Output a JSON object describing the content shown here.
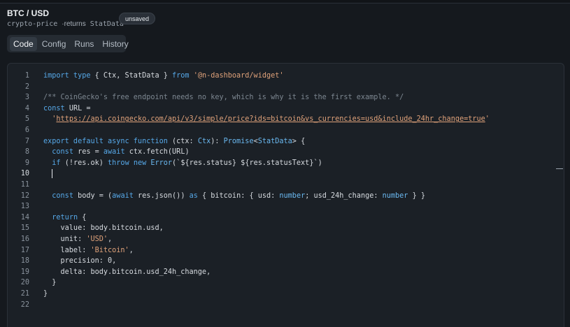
{
  "header": {
    "title": "BTC / USD",
    "widget_id": "crypto-price",
    "separator": "·",
    "returns_label": "returns",
    "return_type": "StatData",
    "badge": "unsaved"
  },
  "tabs": [
    {
      "label": "Code",
      "active": true
    },
    {
      "label": "Config",
      "active": false
    },
    {
      "label": "Runs",
      "active": false
    },
    {
      "label": "History",
      "active": false
    }
  ],
  "editor": {
    "current_line": 10,
    "lines": [
      {
        "n": "1",
        "tokens": [
          [
            "kw",
            "import type "
          ],
          [
            "pn",
            "{ Ctx, StatData } "
          ],
          [
            "kw",
            "from "
          ],
          [
            "str",
            "'@n-dashboard/widget'"
          ]
        ]
      },
      {
        "n": "2",
        "tokens": []
      },
      {
        "n": "3",
        "tokens": [
          [
            "cm",
            "/** CoinGecko's free endpoint needs no key, which is why it is the first example. */"
          ]
        ]
      },
      {
        "n": "4",
        "tokens": [
          [
            "kw",
            "const "
          ],
          [
            "pn",
            "URL ="
          ]
        ]
      },
      {
        "n": "5",
        "tokens": [
          [
            "pn",
            "  "
          ],
          [
            "str",
            "'"
          ],
          [
            "url",
            "https://api.coingecko.com/api/v3/simple/price?ids=bitcoin&vs_currencies=usd&include_24hr_change=true"
          ],
          [
            "str",
            "'"
          ]
        ]
      },
      {
        "n": "6",
        "tokens": []
      },
      {
        "n": "7",
        "tokens": [
          [
            "kw",
            "export default async function "
          ],
          [
            "pn",
            "(ctx: "
          ],
          [
            "ty",
            "Ctx"
          ],
          [
            "pn",
            "): "
          ],
          [
            "ty",
            "Promise"
          ],
          [
            "pn",
            "<"
          ],
          [
            "ty",
            "StatData"
          ],
          [
            "pn",
            "> {"
          ]
        ]
      },
      {
        "n": "8",
        "tokens": [
          [
            "pn",
            "  "
          ],
          [
            "kw",
            "const "
          ],
          [
            "pn",
            "res = "
          ],
          [
            "kw",
            "await "
          ],
          [
            "pn",
            "ctx.fetch(URL)"
          ]
        ]
      },
      {
        "n": "9",
        "tokens": [
          [
            "pn",
            "  "
          ],
          [
            "kw",
            "if "
          ],
          [
            "pn",
            "(!res.ok) "
          ],
          [
            "kw",
            "throw new "
          ],
          [
            "ty",
            "Error"
          ],
          [
            "pn",
            "(`${res.status} ${res.statusText}`)"
          ]
        ]
      },
      {
        "n": "10",
        "tokens": [
          [
            "pn",
            "  "
          ],
          [
            "caret",
            ""
          ]
        ]
      },
      {
        "n": "11",
        "tokens": []
      },
      {
        "n": "12",
        "tokens": [
          [
            "pn",
            "  "
          ],
          [
            "kw",
            "const "
          ],
          [
            "pn",
            "body = ("
          ],
          [
            "kw",
            "await "
          ],
          [
            "pn",
            "res.json()) "
          ],
          [
            "kw",
            "as "
          ],
          [
            "pn",
            "{ bitcoin: { usd: "
          ],
          [
            "ty",
            "number"
          ],
          [
            "pn",
            "; usd_24h_change: "
          ],
          [
            "ty",
            "number"
          ],
          [
            "pn",
            " } }"
          ]
        ]
      },
      {
        "n": "13",
        "tokens": []
      },
      {
        "n": "14",
        "tokens": [
          [
            "pn",
            "  "
          ],
          [
            "kw",
            "return "
          ],
          [
            "pn",
            "{"
          ]
        ]
      },
      {
        "n": "15",
        "tokens": [
          [
            "pn",
            "    value: body.bitcoin.usd,"
          ]
        ]
      },
      {
        "n": "16",
        "tokens": [
          [
            "pn",
            "    unit: "
          ],
          [
            "str",
            "'USD'"
          ],
          [
            "pn",
            ","
          ]
        ]
      },
      {
        "n": "17",
        "tokens": [
          [
            "pn",
            "    label: "
          ],
          [
            "str",
            "'Bitcoin'"
          ],
          [
            "pn",
            ","
          ]
        ]
      },
      {
        "n": "18",
        "tokens": [
          [
            "pn",
            "    precision: 0,"
          ]
        ]
      },
      {
        "n": "19",
        "tokens": [
          [
            "pn",
            "    delta: body.bitcoin.usd_24h_change,"
          ]
        ]
      },
      {
        "n": "20",
        "tokens": [
          [
            "pn",
            "  }"
          ]
        ]
      },
      {
        "n": "21",
        "tokens": [
          [
            "pn",
            "}"
          ]
        ]
      },
      {
        "n": "22",
        "tokens": []
      }
    ]
  }
}
